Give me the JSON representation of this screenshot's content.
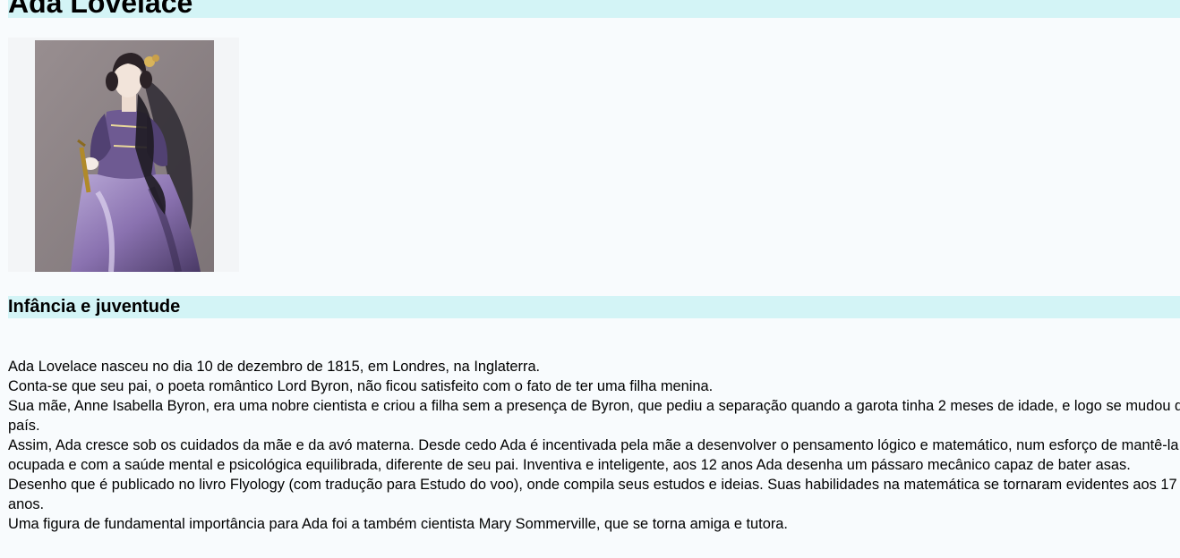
{
  "header": {
    "title": "Ada Lovelace"
  },
  "portrait": {
    "icon": "portrait-image",
    "background_color": "#8c8285"
  },
  "section": {
    "heading": "Infância e juventude"
  },
  "paragraphs": [
    "Ada Lovelace nasceu no dia 10 de dezembro de 1815, em Londres, na Inglaterra.",
    "Conta-se que seu pai, o poeta romântico Lord Byron, não ficou satisfeito com o fato de ter uma filha menina.",
    "Sua mãe, Anne Isabella Byron, era uma nobre cientista e criou a filha sem a presença de Byron, que pediu a separação quando a garota tinha 2 meses de idade, e logo se mudou de país.",
    "Assim, Ada cresce sob os cuidados da mãe e da avó materna. Desde cedo Ada é incentivada pela mãe a desenvolver o pensamento lógico e matemático, num esforço de mantê-la ocupada e com a saúde mental e psicológica equilibrada, diferente de seu pai. Inventiva e inteligente, aos 12 anos Ada desenha um pássaro mecânico capaz de bater asas.",
    "Desenho que é publicado no livro Flyology (com tradução para Estudo do voo), onde compila seus estudos e ideias. Suas habilidades na matemática se tornaram evidentes aos 17 anos.",
    "Uma figura de fundamental importância para Ada foi a também cientista Mary Sommerville, que se torna amiga e tutora."
  ],
  "colors": {
    "page_background": "#f8fbfd",
    "heading_background": "#d3f4f6",
    "text": "#000000"
  }
}
